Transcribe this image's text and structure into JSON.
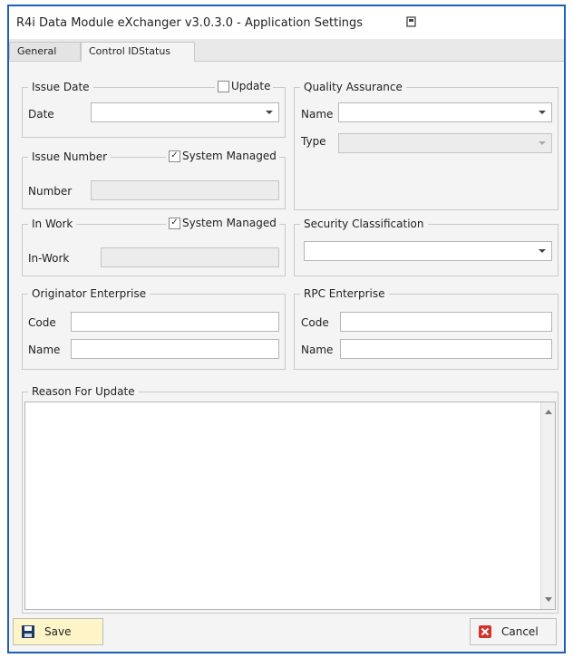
{
  "window": {
    "title": "R4i Data Module eXchanger v3.0.3.0 - Application Settings",
    "title_icon": "window-icon",
    "border_color": "#1f5fb4"
  },
  "tabs": [
    {
      "label": "General",
      "active": false
    },
    {
      "label": "Control IDStatus",
      "active": true
    }
  ],
  "issue_date": {
    "legend": "Issue Date",
    "update_label": "Update",
    "update_checked": false,
    "date_label": "Date",
    "date_value": ""
  },
  "quality_assurance": {
    "legend": "Quality Assurance",
    "name_label": "Name",
    "name_value": "",
    "type_label": "Type",
    "type_value": ""
  },
  "issue_number": {
    "legend": "Issue Number",
    "system_managed_label": "System Managed",
    "system_managed_checked": true,
    "number_label": "Number",
    "number_value": ""
  },
  "in_work": {
    "legend": "In Work",
    "system_managed_label": "System Managed",
    "system_managed_checked": true,
    "in_work_label": "In-Work",
    "in_work_value": ""
  },
  "security_classification": {
    "legend": "Security Classification",
    "value": ""
  },
  "originator_enterprise": {
    "legend": "Originator Enterprise",
    "code_label": "Code",
    "code_value": "",
    "name_label": "Name",
    "name_value": ""
  },
  "rpc_enterprise": {
    "legend": "RPC Enterprise",
    "code_label": "Code",
    "code_value": "",
    "name_label": "Name",
    "name_value": ""
  },
  "reason_for_update": {
    "legend": "Reason For Update",
    "value": ""
  },
  "footer": {
    "save_label": "Save",
    "save_icon": "floppy-disk-icon",
    "save_bg": "#fdf5c8",
    "cancel_label": "Cancel",
    "cancel_icon": "red-x-icon",
    "cancel_color": "#d0342c"
  },
  "checkmark_glyph": "✓"
}
